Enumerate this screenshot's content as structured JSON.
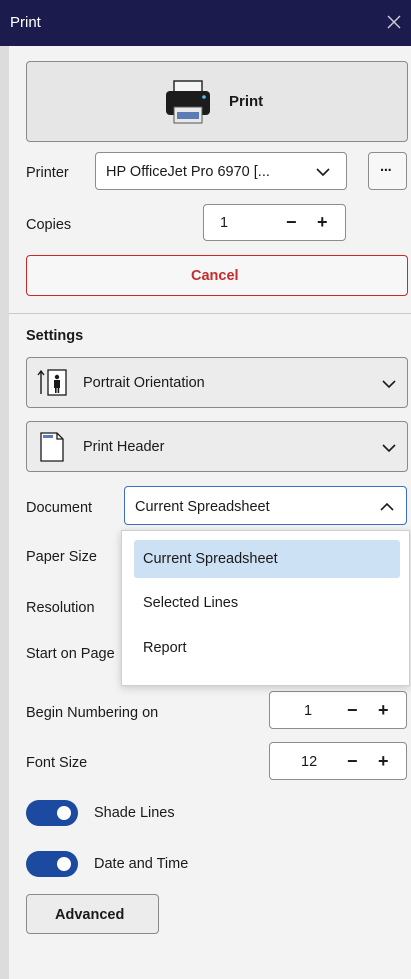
{
  "window": {
    "title": "Print"
  },
  "print_button": {
    "label": "Print"
  },
  "printer": {
    "label": "Printer",
    "value": "HP OfficeJet Pro 6970 [...",
    "more_label": "···"
  },
  "copies": {
    "label": "Copies",
    "value": "1",
    "minus": "−",
    "plus": "+"
  },
  "cancel": {
    "label": "Cancel",
    "color": "#c42b2b"
  },
  "settings": {
    "heading": "Settings",
    "orientation": {
      "label": "Portrait Orientation"
    },
    "header": {
      "label": "Print Header"
    },
    "document": {
      "label": "Document",
      "value": "Current Spreadsheet",
      "options": [
        "Current Spreadsheet",
        "Selected Lines",
        "Report"
      ],
      "selected_index": 0
    },
    "paper_size": {
      "label": "Paper Size"
    },
    "resolution": {
      "label": "Resolution"
    },
    "start_on_page": {
      "label": "Start on Page"
    },
    "begin_numbering": {
      "label": "Begin Numbering on",
      "value": "1",
      "minus": "−",
      "plus": "+"
    },
    "font_size": {
      "label": "Font Size",
      "value": "12",
      "minus": "−",
      "plus": "+"
    },
    "shade_lines": {
      "label": "Shade Lines",
      "on": true
    },
    "date_time": {
      "label": "Date and Time",
      "on": true
    },
    "advanced": {
      "label": "Advanced"
    }
  },
  "colors": {
    "titlebar": "#1b1b4e",
    "toggle_on": "#1c4aa0",
    "selection": "#cde1f5"
  }
}
